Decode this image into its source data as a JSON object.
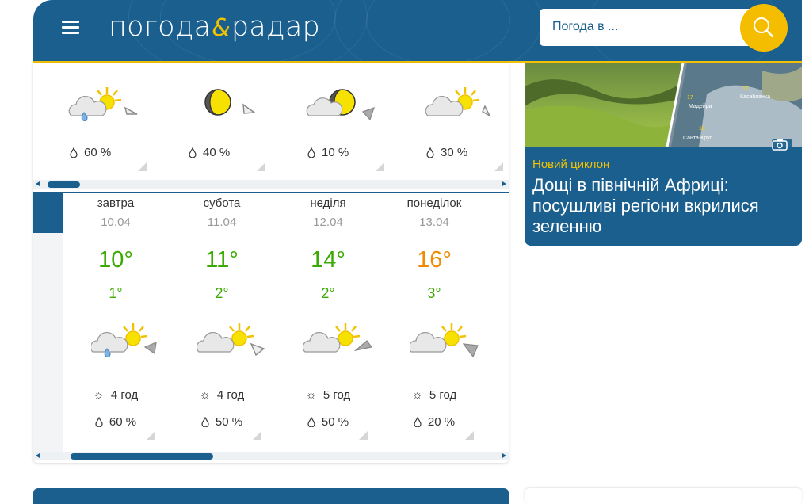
{
  "header": {
    "logo_part1": "погода",
    "logo_amp": "&",
    "logo_part2": "радар",
    "search_placeholder": "Погода в ...",
    "colors": {
      "bar": "#1a5f8e",
      "accent": "#f5bd00"
    }
  },
  "hourly_top": [
    {
      "precip": "60 %",
      "icon": "sun-cloud-rain-icon"
    },
    {
      "precip": "40 %",
      "icon": "moon-icon"
    },
    {
      "precip": "10 %",
      "icon": "cloud-moon-icon"
    },
    {
      "precip": "30 %",
      "icon": "sun-cloud-icon"
    }
  ],
  "days": [
    {
      "name": "завтра",
      "date": "10.04",
      "tmax": "10°",
      "tmin": "1°",
      "sun": "4 год",
      "precip": "60 %",
      "tmax_color": "#3aaa00",
      "icon": "sun-cloud-rain-icon"
    },
    {
      "name": "субота",
      "date": "11.04",
      "tmax": "11°",
      "tmin": "2°",
      "sun": "4 год",
      "precip": "50 %",
      "tmax_color": "#3aaa00",
      "icon": "sun-cloud-icon"
    },
    {
      "name": "неділя",
      "date": "12.04",
      "tmax": "14°",
      "tmin": "2°",
      "sun": "5 год",
      "precip": "50 %",
      "tmax_color": "#3aaa00",
      "icon": "sun-cloud-icon"
    },
    {
      "name": "понеділок",
      "date": "13.04",
      "tmax": "16°",
      "tmin": "3°",
      "sun": "5 год",
      "precip": "20 %",
      "tmax_color": "#f08a00",
      "icon": "sun-cloud-icon"
    }
  ],
  "news": {
    "tag": "Новий циклон",
    "title": "Дощі в північній Африці: посушливі регіони вкрилися зеленню",
    "map_labels": [
      "Касабланка",
      "Мадейра",
      "Санта-Крус",
      "17",
      "17",
      "18"
    ]
  }
}
